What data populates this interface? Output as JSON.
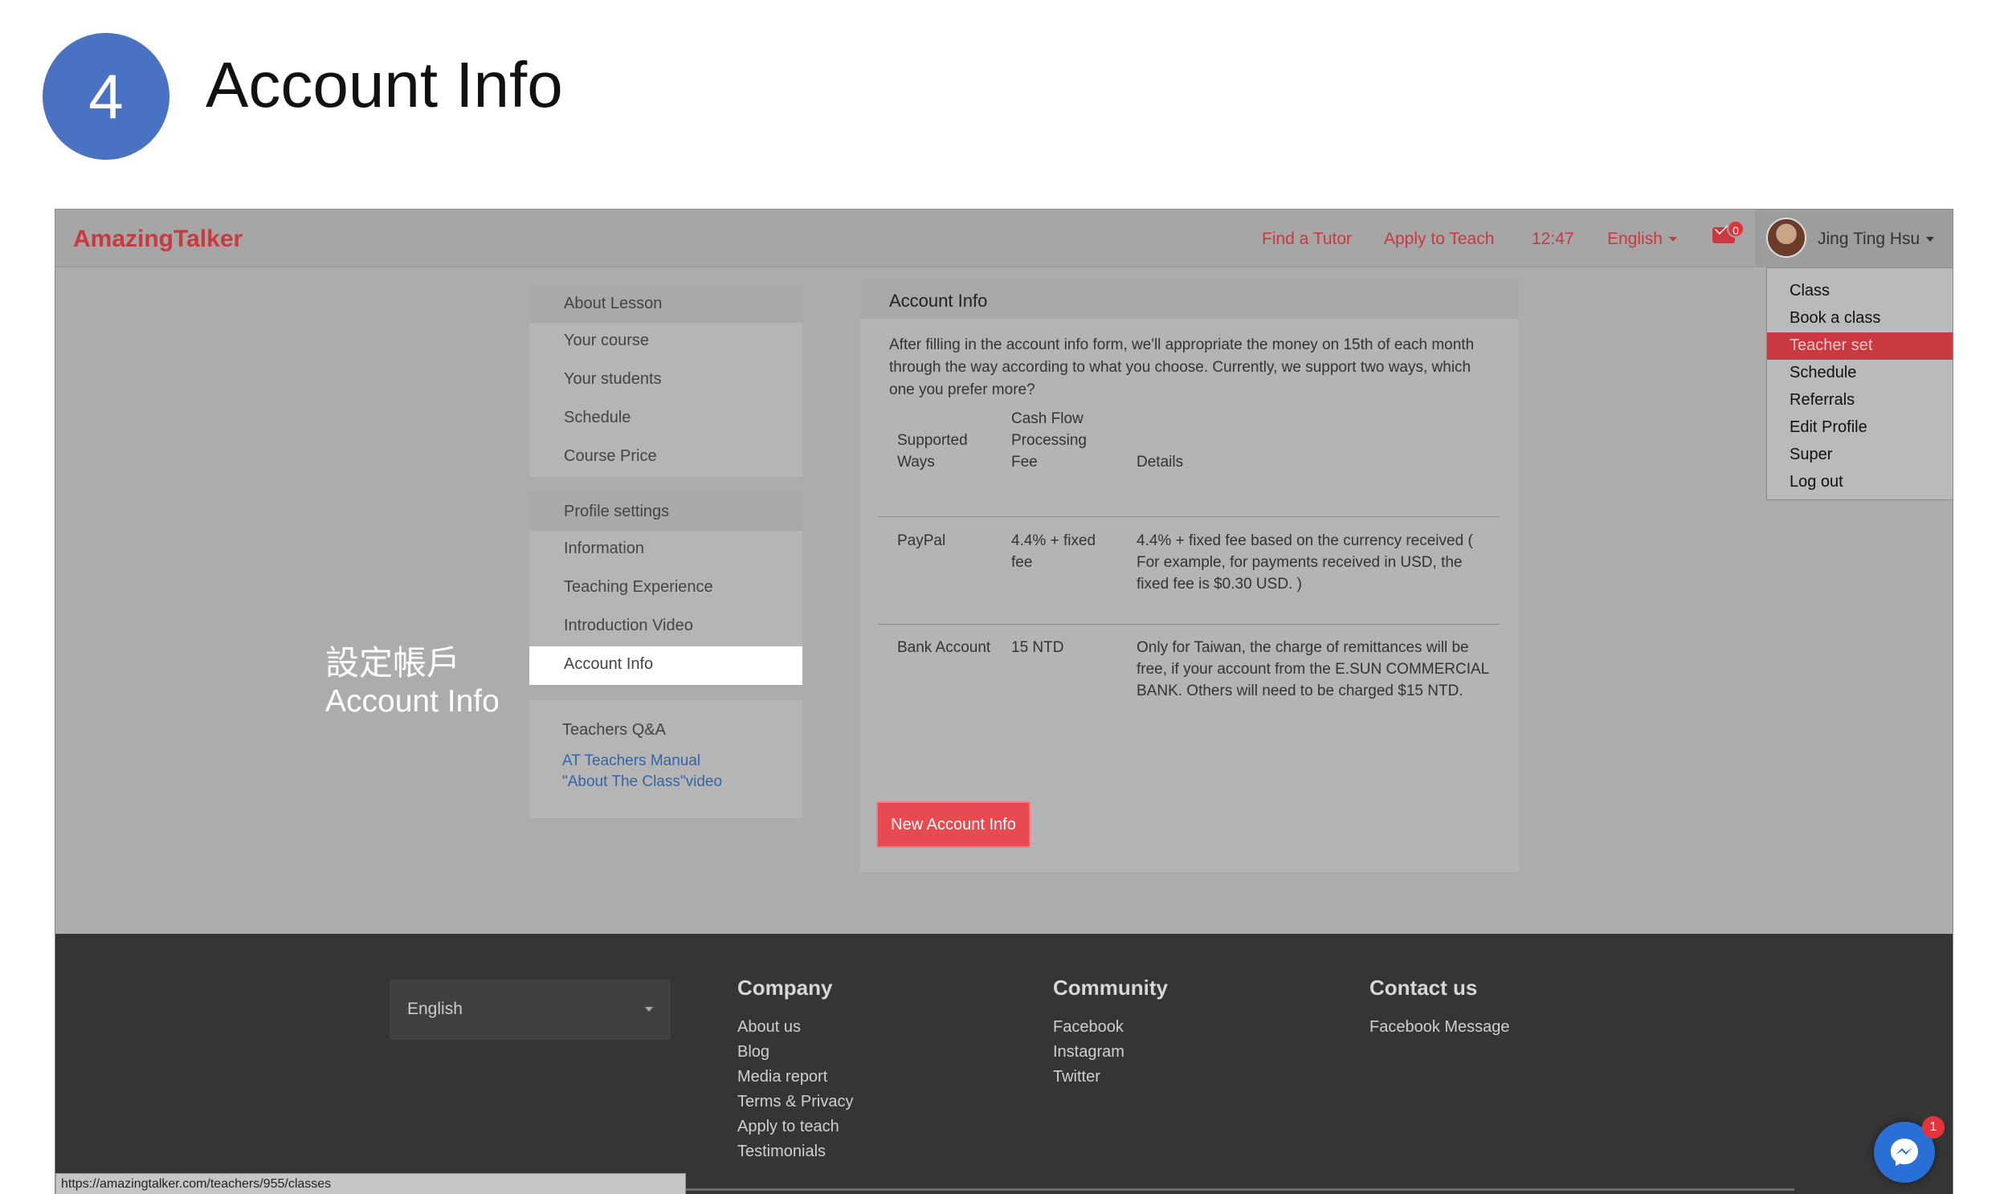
{
  "slide": {
    "step": "4",
    "title": "Account Info"
  },
  "nav": {
    "brand": "AmazingTalker",
    "find_tutor": "Find a Tutor",
    "apply_teach": "Apply to Teach",
    "time": "12:47",
    "language": "English",
    "mail_count": "0",
    "user_name": "Jing Ting Hsu"
  },
  "menu": {
    "group1": {
      "head": "About Lesson",
      "items": [
        "Your course",
        "Your students",
        "Schedule",
        "Course Price"
      ]
    },
    "group2": {
      "head": "Profile settings",
      "items": [
        "Information",
        "Teaching Experience",
        "Introduction Video",
        "Account Info"
      ]
    },
    "qa": {
      "title": "Teachers Q&A",
      "link1": "AT Teachers Manual",
      "link2": "\"About The Class\"video"
    }
  },
  "annotation": {
    "zh": "設定帳戶",
    "en": "Account Info"
  },
  "panel": {
    "title": "Account Info",
    "intro": "After filling in the account info form, we'll appropriate the money on 15th of each month through the way according to what you choose. Currently, we support two ways, which one you prefer more?",
    "columns": [
      "Supported Ways",
      "Cash Flow Processing Fee",
      "Details"
    ],
    "rows": [
      {
        "way": "PayPal",
        "fee": "4.4% + fixed fee",
        "details": "4.4% + fixed fee based on the currency received ( For example, for payments received in USD, the fixed fee is $0.30 USD. )"
      },
      {
        "way": "Bank Account",
        "fee": "15 NTD",
        "details": "Only for Taiwan, the charge of remittances will be free, if your account from the E.SUN COMMERCIAL BANK. Others will need to be charged $15 NTD."
      }
    ],
    "button": "New Account Info"
  },
  "dropdown": {
    "items": [
      "Class",
      "Book a class",
      "Teacher set",
      "Schedule",
      "Referrals",
      "Edit Profile",
      "Super",
      "Log out"
    ],
    "active": "Teacher set"
  },
  "footer": {
    "language": "English",
    "company": {
      "head": "Company",
      "links": [
        "About us",
        "Blog",
        "Media report",
        "Terms & Privacy",
        "Apply to teach",
        "Testimonials"
      ]
    },
    "community": {
      "head": "Community",
      "links": [
        "Facebook",
        "Instagram",
        "Twitter"
      ]
    },
    "contact": {
      "head": "Contact us",
      "links": [
        "Facebook Message"
      ]
    }
  },
  "status_url": "https://amazingtalker.com/teachers/955/classes",
  "messenger_badge": "1",
  "colors": {
    "brand_red": "#c9393f",
    "step_blue": "#4a72c2",
    "button_red": "#e84a52",
    "link_blue": "#2f66a8"
  }
}
